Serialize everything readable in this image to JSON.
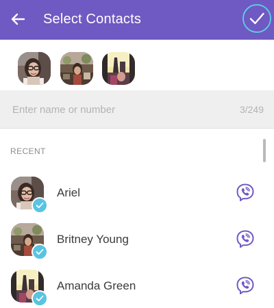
{
  "header": {
    "title": "Select Contacts",
    "back_icon": "arrow-left-icon",
    "confirm_icon": "checkmark-icon",
    "background": "#6f59c2",
    "confirm_ring_color": "#5fc7e3"
  },
  "selected": {
    "avatars": [
      {
        "contact": "Ariel",
        "icon": "avatar-photo"
      },
      {
        "contact": "Britney Young",
        "icon": "avatar-photo"
      },
      {
        "contact": "Amanda Green",
        "icon": "avatar-photo"
      }
    ]
  },
  "search": {
    "placeholder": "Enter name or number",
    "value": "",
    "counter": "3/249"
  },
  "section": {
    "label": "RECENT"
  },
  "contacts": [
    {
      "name": "Ariel",
      "selected": true,
      "call_icon": "viber-call-icon"
    },
    {
      "name": "Britney Young",
      "selected": true,
      "call_icon": "viber-call-icon"
    },
    {
      "name": "Amanda Green",
      "selected": true,
      "call_icon": "viber-call-icon"
    }
  ],
  "colors": {
    "accent": "#6f59c2",
    "check_badge": "#59c4e2",
    "viber_icon": "#6f59c2"
  }
}
